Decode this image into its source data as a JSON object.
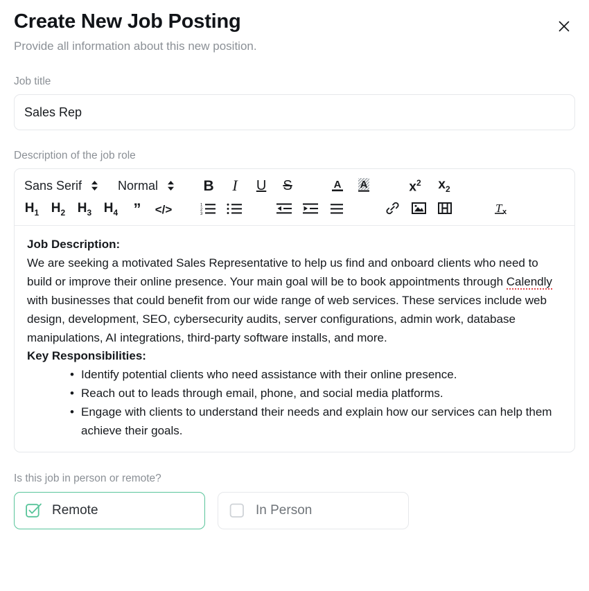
{
  "dialog": {
    "title": "Create New Job Posting",
    "subtitle": "Provide all information about this new position.",
    "close_icon": "close-icon"
  },
  "job_title_field": {
    "label": "Job title",
    "value": "Sales Rep",
    "placeholder": "Job title"
  },
  "description_field": {
    "label": "Description of the job role",
    "toolbar": {
      "font_family": {
        "value": "Sans Serif",
        "icon": "stepper-icon"
      },
      "font_size": {
        "value": "Normal",
        "icon": "stepper-icon"
      },
      "row1": [
        {
          "name": "bold-button",
          "glyph": "B"
        },
        {
          "name": "italic-button",
          "glyph": "I"
        },
        {
          "name": "underline-button",
          "glyph": "U"
        },
        {
          "name": "strikethrough-button",
          "glyph": "S"
        },
        {
          "name": "text-color-button",
          "glyph": "A"
        },
        {
          "name": "highlight-color-button",
          "glyph": "A"
        },
        {
          "name": "superscript-button",
          "glyph": "x2"
        },
        {
          "name": "subscript-button",
          "glyph": "x2"
        }
      ],
      "row2": [
        {
          "name": "heading-1-button",
          "glyph": "H1"
        },
        {
          "name": "heading-2-button",
          "glyph": "H2"
        },
        {
          "name": "heading-3-button",
          "glyph": "H3"
        },
        {
          "name": "heading-4-button",
          "glyph": "H4"
        },
        {
          "name": "blockquote-button",
          "glyph": "”"
        },
        {
          "name": "code-block-button",
          "glyph": "</>"
        },
        {
          "name": "ordered-list-button",
          "glyph": "ordered-list"
        },
        {
          "name": "bullet-list-button",
          "glyph": "bullet-list"
        },
        {
          "name": "outdent-button",
          "glyph": "outdent"
        },
        {
          "name": "indent-button",
          "glyph": "indent"
        },
        {
          "name": "align-button",
          "glyph": "align"
        },
        {
          "name": "link-button",
          "glyph": "link"
        },
        {
          "name": "image-button",
          "glyph": "image"
        },
        {
          "name": "video-button",
          "glyph": "video"
        },
        {
          "name": "clear-formatting-button",
          "glyph": "Tx"
        }
      ]
    },
    "content": {
      "heading_1": "Job Description:",
      "paragraph_1_a": "We are seeking a motivated Sales Representative to help us find and onboard clients who need to build or improve their online presence. Your main goal will be to book appointments through ",
      "paragraph_1_misspelled": "Calendly",
      "paragraph_1_b": " with businesses that could benefit from our wide range of web services. These services include web design, development, SEO, cybersecurity audits, server configurations, admin work, database manipulations, AI integrations, third-party software installs, and more.",
      "heading_2": "Key Responsibilities:",
      "bullets": [
        "Identify potential clients who need assistance with their online presence.",
        "Reach out to leads through email, phone, and social media platforms.",
        "Engage with clients to understand their needs and explain how our services can help them achieve their goals."
      ]
    }
  },
  "location_field": {
    "label": "Is this job in person or remote?",
    "options": [
      {
        "label": "Remote",
        "selected": true,
        "icon": "checkbox-checked-icon"
      },
      {
        "label": "In Person",
        "selected": false,
        "icon": "checkbox-unchecked-icon"
      }
    ]
  },
  "colors": {
    "accent_green": "#58c49a",
    "border": "#e6e8eb",
    "text_primary": "#16191d",
    "text_muted": "#8b9096",
    "spellcheck_red": "#e5484d"
  }
}
